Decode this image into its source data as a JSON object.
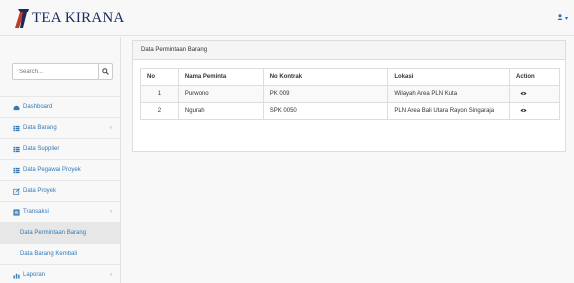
{
  "brand": {
    "name": "TEA KIRANA"
  },
  "user_menu": {
    "caret": "▾"
  },
  "search": {
    "placeholder": "Search..."
  },
  "sidebar": {
    "items": [
      {
        "label": "Dashboard",
        "icon": "dashboard-icon",
        "has_children": false
      },
      {
        "label": "Data Barang",
        "icon": "table-icon",
        "has_children": true
      },
      {
        "label": "Data Supplier",
        "icon": "table-icon",
        "has_children": false
      },
      {
        "label": "Data Pegawai Proyek",
        "icon": "table-icon",
        "has_children": false
      },
      {
        "label": "Data Proyek",
        "icon": "edit-icon",
        "has_children": false
      },
      {
        "label": "Transaksi",
        "icon": "list-icon",
        "has_children": true
      },
      {
        "label": "Data Permintaan Barang",
        "sub": true,
        "active": true
      },
      {
        "label": "Data Barang Kembali",
        "sub": true
      },
      {
        "label": "Laporan",
        "icon": "bar-chart-icon",
        "has_children": true
      }
    ]
  },
  "panel": {
    "title": "Data Permintaan Barang"
  },
  "table": {
    "headers": [
      "No",
      "Nama Peminta",
      "No Kontrak",
      "Lokasi",
      "Action"
    ],
    "rows": [
      [
        "1",
        "Purwono",
        "PK 009",
        "Wilayah Area PLN Kuta"
      ],
      [
        "2",
        "Ngurah",
        "SPK 0050",
        "PLN Area Bali Utara Rayon Singaraja"
      ]
    ]
  },
  "colors": {
    "link": "#337ab7",
    "brand": "#1b2a5e"
  }
}
